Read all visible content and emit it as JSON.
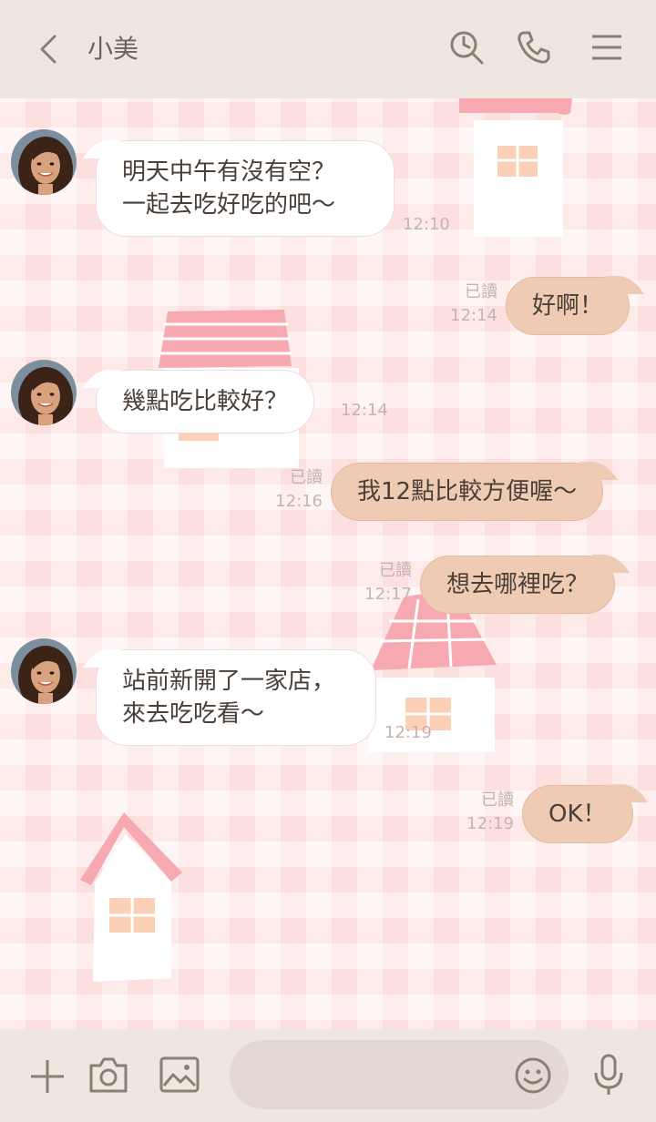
{
  "header": {
    "title": "小美",
    "icons": [
      "back-icon",
      "search-icon",
      "phone-icon",
      "menu-icon"
    ]
  },
  "messages": [
    {
      "side": "in",
      "lines": [
        "明天中午有沒有空？",
        "一起去吃好吃的吧～"
      ],
      "time": "12:10"
    },
    {
      "side": "out",
      "text": "好啊！",
      "read": "已讀",
      "time": "12:14"
    },
    {
      "side": "in",
      "lines": [
        "幾點吃比較好？"
      ],
      "time": "12:14"
    },
    {
      "side": "out",
      "text": "我12點比較方便喔～",
      "read": "已讀",
      "time": "12:16"
    },
    {
      "side": "out",
      "text": "想去哪裡吃？",
      "read": "已讀",
      "time": "12:17"
    },
    {
      "side": "in",
      "lines": [
        "站前新開了一家店，",
        "來去吃吃看～"
      ],
      "time": "12:19"
    },
    {
      "side": "out",
      "text": "OK！",
      "read": "已讀",
      "time": "12:19"
    }
  ],
  "footer": {
    "icons": [
      "plus-icon",
      "camera-icon",
      "image-icon",
      "emoji-icon",
      "mic-icon"
    ],
    "input_placeholder": ""
  },
  "colors": {
    "header_bg": "#eee7df",
    "incoming_bubble": "#ffffff",
    "outgoing_bubble": "#efcbb4",
    "background": "#fdecea"
  }
}
